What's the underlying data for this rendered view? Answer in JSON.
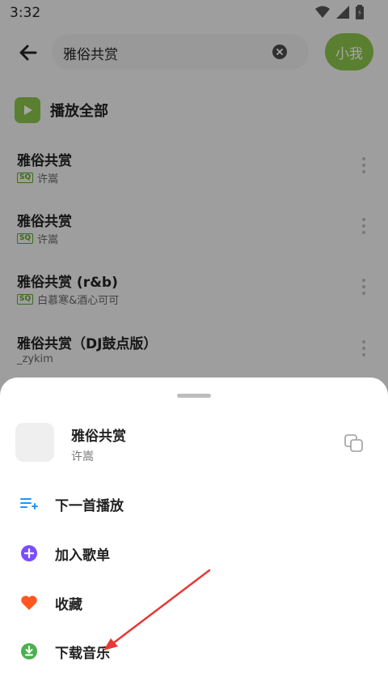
{
  "status_bar": {
    "time": "3:32"
  },
  "search": {
    "query": "雅俗共赏",
    "user_button": "小我"
  },
  "play_all": {
    "label": "播放全部"
  },
  "songs": [
    {
      "title": "雅俗共赏",
      "quality": "SQ",
      "artist": "许嵩"
    },
    {
      "title": "雅俗共赏",
      "quality": "SQ",
      "artist": "许嵩"
    },
    {
      "title": "雅俗共赏 (r&b)",
      "quality": "SQ",
      "artist": "白慕寒&酒心可可"
    },
    {
      "title": "雅俗共赏（DJ鼓点版）",
      "quality": "",
      "artist": "_zykim"
    }
  ],
  "sheet": {
    "song_title": "雅俗共赏",
    "artist": "许嵩",
    "actions": [
      {
        "label": "下一首播放",
        "icon": "play-next-icon",
        "color": "#2196f3"
      },
      {
        "label": "加入歌单",
        "icon": "add-playlist-icon",
        "color": "#7c4dff"
      },
      {
        "label": "收藏",
        "icon": "heart-icon",
        "color": "#ff5722"
      },
      {
        "label": "下载音乐",
        "icon": "download-icon",
        "color": "#4caf50"
      }
    ]
  },
  "colors": {
    "accent": "#8bc34a",
    "annotation_arrow": "#e53935"
  }
}
